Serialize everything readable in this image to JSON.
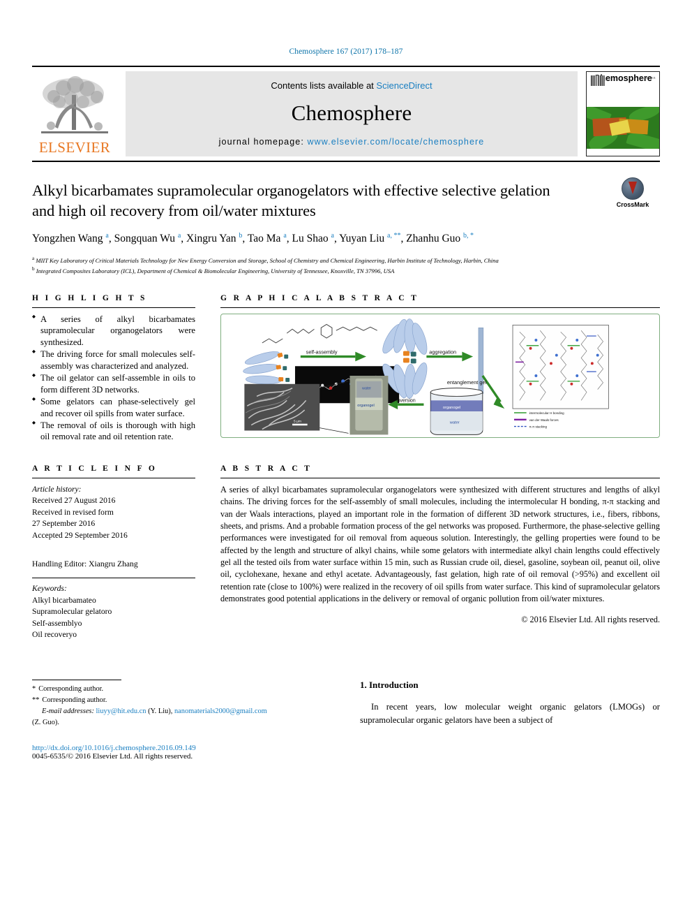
{
  "running_head": "Chemosphere 167 (2017) 178–187",
  "masthead": {
    "publisher_logo_text": "ELSEVIER",
    "contents_prefix": "Contents lists available at",
    "contents_link": "ScienceDirect",
    "journal_name": "Chemosphere",
    "homepage_prefix": "journal homepage:",
    "homepage_url": "www.elsevier.com/locate/chemosphere",
    "cover_title": "Chemosphere",
    "cover_small_text": "ELSEVIER"
  },
  "article": {
    "title": "Alkyl bicarbamates supramolecular organogelators with effective selective gelation and high oil recovery from oil/water mixtures",
    "authors": [
      {
        "name": "Yongzhen Wang",
        "marks": "a"
      },
      {
        "name": "Songquan Wu",
        "marks": "a"
      },
      {
        "name": "Xingru Yan",
        "marks": "b"
      },
      {
        "name": "Tao Ma",
        "marks": "a"
      },
      {
        "name": "Lu Shao",
        "marks": "a"
      },
      {
        "name": "Yuyan Liu",
        "marks": "a, **"
      },
      {
        "name": "Zhanhu Guo",
        "marks": "b, *"
      }
    ],
    "affiliations": [
      {
        "mark": "a",
        "text": "MIIT Key Laboratory of Critical Materials Technology for New Energy Conversion and Storage, School of Chemistry and Chemical Engineering, Harbin Institute of Technology, Harbin, China"
      },
      {
        "mark": "b",
        "text": "Integrated Composites Laboratory (ICL), Department of Chemical & Biomolecular Engineering, University of Tennessee, Knoxville, TN 37996, USA"
      }
    ],
    "crossmark_label": "CrossMark"
  },
  "highlights": {
    "heading": "H I G H L I G H T S",
    "items": [
      "A series of alkyl bicarbamates supramolecular organogelators were synthesized.",
      "The driving force for small molecules self-assembly was characterized and analyzed.",
      "The oil gelator can self-assemble in oils to form different 3D networks.",
      "Some gelators can phase-selectively gel and recover oil spills from water surface.",
      "The removal of oils is thorough with high oil removal rate and oil retention rate."
    ]
  },
  "graphical_abstract": {
    "heading": "G R A P H I C A L  A B S T R A C T",
    "labels": {
      "self_assembly": "self-assembly",
      "aggregation": "aggregation",
      "entanglement_gel": "entanglement gel",
      "inversion": "inversion",
      "organogel_vial": "organogel",
      "water_vial": "water",
      "organogel_beaker": "organogel",
      "water_beaker": "water",
      "scale_bar": "5 µm"
    },
    "legend": [
      {
        "label": "intermolecular H bonding",
        "color": "#2e9b2e"
      },
      {
        "label": "van der Waals forces",
        "color": "#7d1fa0"
      },
      {
        "label": "π-π stacking",
        "color": "#2a4fc0"
      }
    ]
  },
  "article_info": {
    "heading": "A R T I C L E  I N F O",
    "history_label": "Article history:",
    "history": [
      "Received 27 August 2016",
      "Received in revised form",
      "27 September 2016",
      "Accepted 29 September 2016"
    ],
    "handling_editor": "Handling Editor: Xiangru Zhang",
    "keywords_label": "Keywords:",
    "keywords": [
      "Alkyl bicarbamateo",
      "Supramolecular gelatoro",
      "Self-assemblyo",
      "Oil recoveryo"
    ]
  },
  "abstract": {
    "heading": "A B S T R A C T",
    "text": "A series of alkyl bicarbamates supramolecular organogelators were synthesized with different structures and lengths of alkyl chains. The driving forces for the self-assembly of small molecules, including the intermolecular H bonding, π-π stacking and van der Waals interactions, played an important role in the formation of different 3D network structures, i.e., fibers, ribbons, sheets, and prisms. And a probable formation process of the gel networks was proposed. Furthermore, the phase-selective gelling performances were investigated for oil removal from aqueous solution. Interestingly, the gelling properties were found to be affected by the length and structure of alkyl chains, while some gelators with intermediate alkyl chain lengths could effectively gel all the tested oils from water surface within 15 min, such as Russian crude oil, diesel, gasoline, soybean oil, peanut oil, olive oil, cyclohexane, hexane and ethyl acetate. Advantageously, fast gelation, high rate of oil removal (>95%) and excellent oil retention rate (close to 100%) were realized in the recovery of oil spills from water surface. This kind of supramolecular gelators demonstrates good potential applications in the delivery or removal of organic pollution from oil/water mixtures.",
    "copyright": "© 2016 Elsevier Ltd. All rights reserved."
  },
  "footer": {
    "corresponding_single": "Corresponding author.",
    "corresponding_double": "Corresponding author.",
    "email_label": "E-mail addresses:",
    "email_1": "liuyy@hit.edu.cn",
    "email_1_owner": "(Y. Liu),",
    "email_2": "nanomaterials2000@gmail.com",
    "email_2_owner": "(Z. Guo).",
    "doi": "http://dx.doi.org/10.1016/j.chemosphere.2016.09.149",
    "issn": "0045-6535/© 2016 Elsevier Ltd. All rights reserved."
  },
  "introduction": {
    "heading": "1. Introduction",
    "paragraph": "In recent years, low molecular weight organic gelators (LMOGs) or supramolecular organic gelators have been a subject of"
  }
}
